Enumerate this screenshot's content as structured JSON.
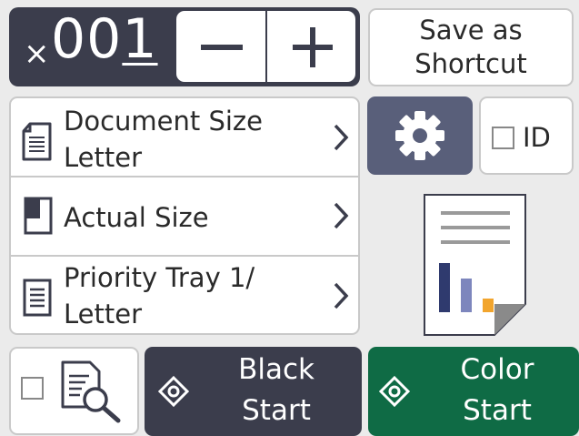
{
  "copies": {
    "prefix": "×",
    "count_main": "00",
    "count_active_digit": "1"
  },
  "stepper": {
    "minus_icon": "minus-icon",
    "plus_icon": "plus-icon"
  },
  "shortcut": {
    "line1": "Save as",
    "line2": "Shortcut"
  },
  "settings": [
    {
      "icon": "document-icon",
      "line1": "Document Size",
      "line2": "Letter"
    },
    {
      "icon": "page-corner-icon",
      "line1": "Actual Size"
    },
    {
      "icon": "tray-icon",
      "line1": "Priority Tray 1/",
      "line2": "Letter"
    }
  ],
  "options": {
    "gear_icon": "gear-icon",
    "id_label": "ID"
  },
  "start": {
    "black_line1": "Black",
    "black_line2": "Start",
    "color_line1": "Color",
    "color_line2": "Start"
  },
  "colors": {
    "dark": "#3b3d4c",
    "gear": "#595f7a",
    "color_start": "#0f6b45",
    "bar_navy": "#2f3a6e",
    "bar_purple": "#7d86bd",
    "bar_orange": "#f2a52d"
  }
}
